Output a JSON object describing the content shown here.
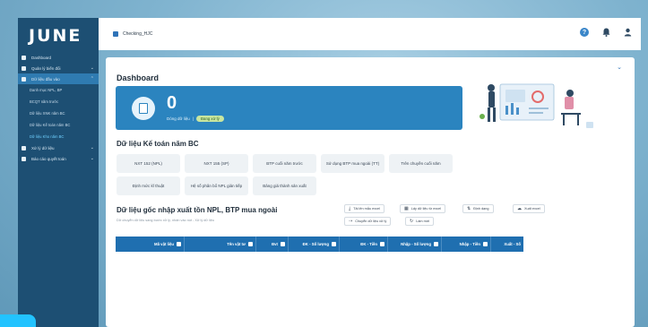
{
  "app": {
    "logo": "JUNE",
    "tab_label": "Checking_HJC"
  },
  "sidebar": {
    "items": [
      {
        "label": "Dashboard",
        "has_children": false
      },
      {
        "label": "Quản lý biến đổi",
        "has_children": true
      },
      {
        "label": "Dữ liệu đầu vào",
        "has_children": true,
        "active": true
      }
    ],
    "sub_items": [
      {
        "label": "Danh mục NPL, BP"
      },
      {
        "label": "BCQT năm trước"
      },
      {
        "label": "Dữ liệu XNK năm BC"
      },
      {
        "label": "Dữ liệu Kế toán năm BC"
      },
      {
        "label": "Dữ liệu Kho năm BC",
        "active": true
      }
    ],
    "items_after": [
      {
        "label": "Xử lý dữ liệu",
        "has_children": true
      },
      {
        "label": "Báo cáo quyết toán",
        "has_children": true
      }
    ]
  },
  "topbar": {
    "icons": [
      "help-icon",
      "bell-icon",
      "user-icon"
    ]
  },
  "page": {
    "title": "Dashboard",
    "collapse_icon": "chevron-down-icon"
  },
  "banner": {
    "count": "0",
    "label": "Dòng dữ liệu",
    "separator": "|",
    "pill": "Đang xử lý"
  },
  "accounting_section": {
    "title": "Dữ liệu Kế toán năm BC",
    "buttons": [
      "NXT 152 (NPL)",
      "NXT 155 (SP)",
      "BTP cuối năm trước",
      "Sử dụng BTP mua ngoài (TT)",
      "Trên chuyền cuối năm",
      "Định mức kĩ thuật",
      "Hệ số phân bổ NPL giản tiếp",
      "Bảng giá thành sản xuất"
    ]
  },
  "inventory_section": {
    "title": "Dữ liệu gốc nhập xuất tồn NPL, BTP mua ngoài",
    "subtitle": "Dữ chuyển dữ liệu sang bước xử lý, nhấn vào nút - Xử lý dữ liệu",
    "actions": [
      {
        "icon": "download-icon",
        "label": "Tải lên mẫu excel"
      },
      {
        "icon": "table-icon",
        "label": "Lấy dữ liệu từ excel"
      },
      {
        "icon": "sort-icon",
        "label": "Định dạng"
      },
      {
        "icon": "cloud-icon",
        "label": "Xuất excel"
      },
      {
        "icon": "arrow-icon",
        "label": "Chuyển dữ liệu xử lý"
      },
      {
        "icon": "refresh-icon",
        "label": "Làm mới"
      }
    ],
    "columns": [
      "Mã vật liệu",
      "Tên vật tư",
      "Đvt",
      "ĐK - Số lượng",
      "ĐK - Tiền",
      "Nhập - Số lượng",
      "Nhập - Tiền",
      "Xuất - Số"
    ]
  },
  "colors": {
    "sidebar": "#1d4f73",
    "accent": "#2b84bf",
    "table_header": "#1f6fb0"
  }
}
